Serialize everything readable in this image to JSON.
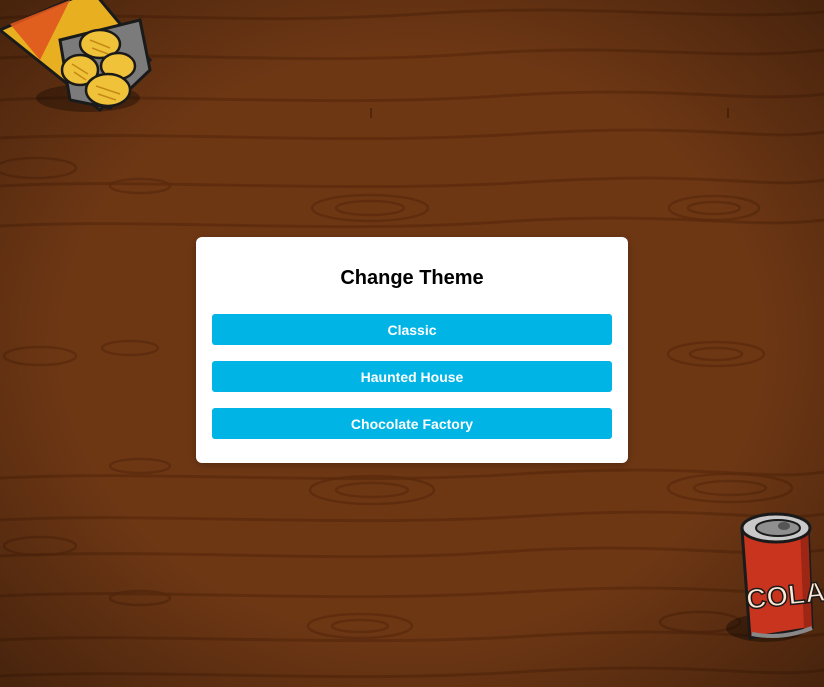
{
  "modal": {
    "title": "Change Theme",
    "buttons": [
      {
        "label": "Classic"
      },
      {
        "label": "Haunted House"
      },
      {
        "label": "Chocolate Factory"
      }
    ]
  },
  "decorations": {
    "can_text": "COLA",
    "colors": {
      "table": "#6b3613",
      "button": "#00b5e6",
      "can": "#c9341e"
    }
  }
}
